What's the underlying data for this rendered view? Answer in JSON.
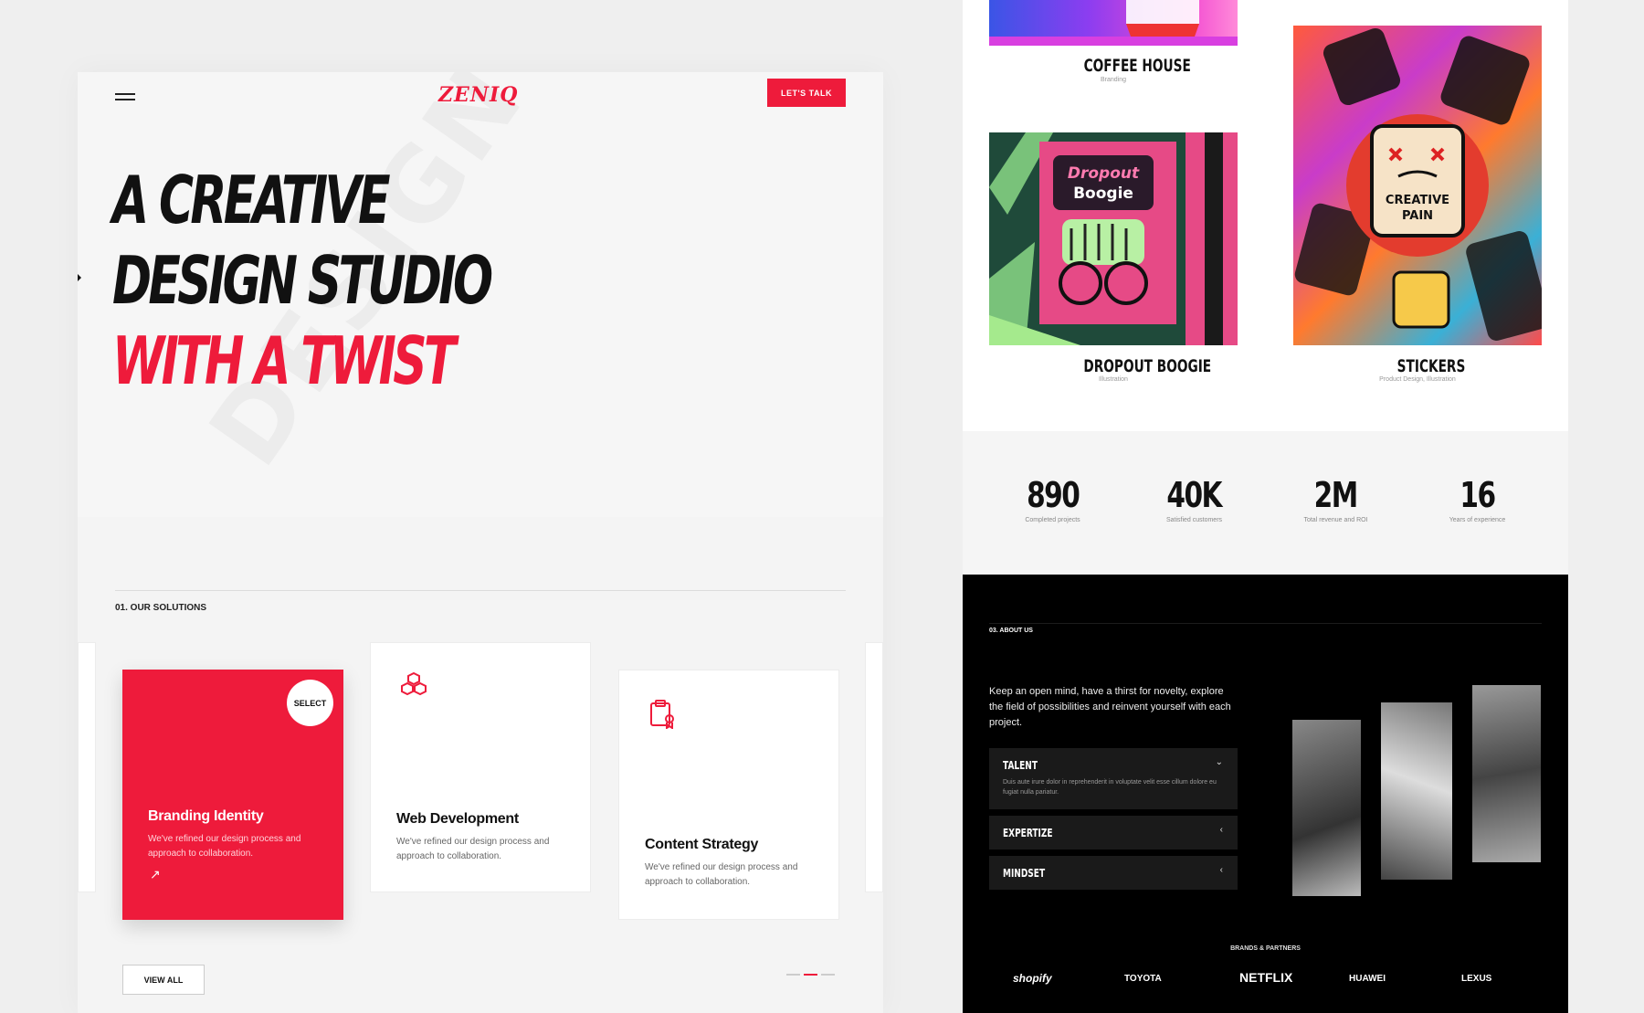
{
  "left": {
    "logo": "ZENIQ",
    "talk_button": "LET'S TALK",
    "headline": [
      "A CREATIVE",
      "DESIGN STUDIO",
      "WITH A TWIST"
    ],
    "solutions_label": "01. OUR SOLUTIONS",
    "cards": [
      {
        "title": "Branding Identity",
        "desc": "We've refined our design process and approach to collaboration.",
        "badge": "SELECT"
      },
      {
        "title": "Web Development",
        "desc": "We've refined our design process and approach to collaboration."
      },
      {
        "title": "Content Strategy",
        "desc": "We've refined our design process and approach to collaboration."
      }
    ],
    "view_all": "VIEW ALL"
  },
  "right": {
    "projects": [
      {
        "title": "COFFEE HOUSE",
        "sub": "Branding"
      },
      {
        "title": "DROPOUT BOOGIE",
        "sub": "Illustration"
      },
      {
        "title": "STICKERS",
        "sub": "Product Design, Illustration"
      }
    ],
    "stats": [
      {
        "num": "890",
        "label": "Completed projects"
      },
      {
        "num": "40K",
        "label": "Satisfied customers"
      },
      {
        "num": "2M",
        "label": "Total revenue and ROI"
      },
      {
        "num": "16",
        "label": "Years of experience"
      }
    ],
    "about_label": "03. ABOUT US",
    "about_text": "Keep an open mind, have a thirst for novelty, explore the field of possibilities and reinvent yourself with each project.",
    "accordion": [
      {
        "title": "TALENT",
        "desc": "Duis aute irure dolor in reprehenderit in voluptate velit esse cillum dolore eu fugiat nulla pariatur."
      },
      {
        "title": "EXPERTIZE"
      },
      {
        "title": "MINDSET"
      }
    ],
    "brands_label": "BRANDS & PARTNERS",
    "brands": [
      "shopify",
      "TOYOTA",
      "NETFLIX",
      "HUAWEI",
      "LEXUS"
    ]
  }
}
